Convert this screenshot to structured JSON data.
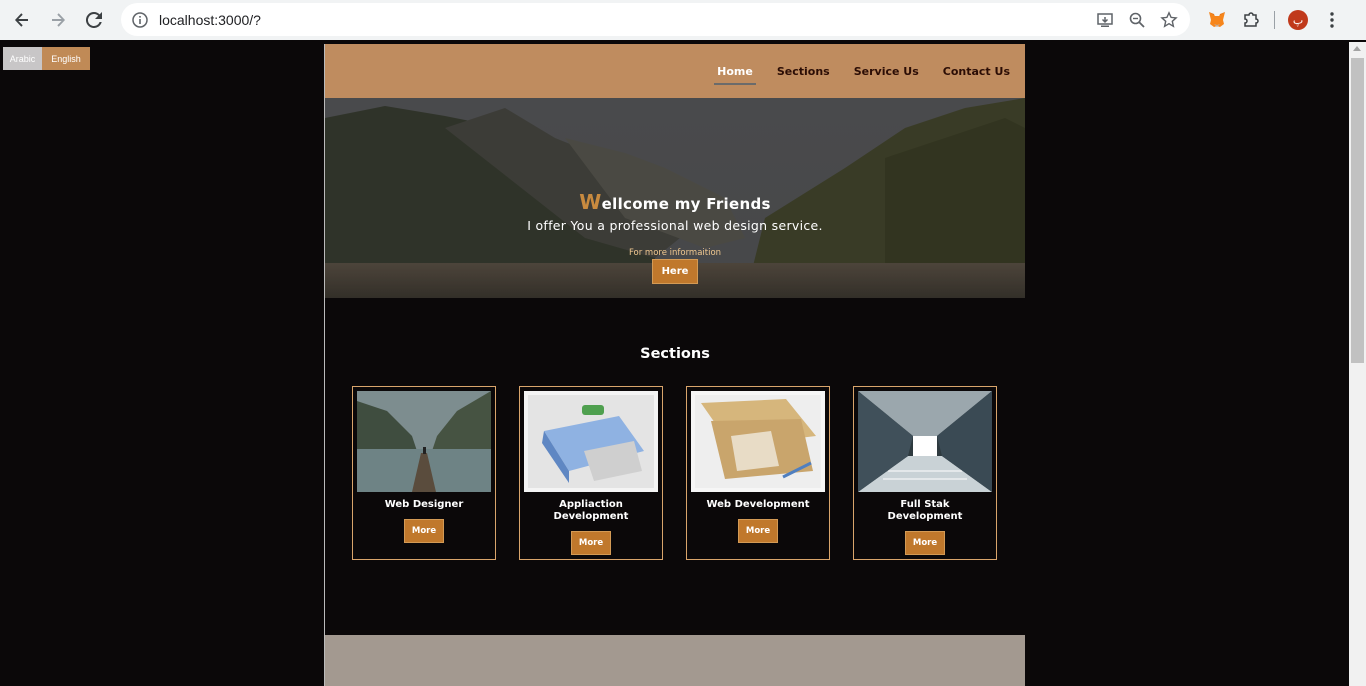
{
  "browser": {
    "url": "localhost:3000/?",
    "profile_initial": "پ"
  },
  "lang_switch": {
    "arabic": "Arabic",
    "english": "English"
  },
  "nav": {
    "items": [
      {
        "label": "Home",
        "active": true
      },
      {
        "label": "Sections",
        "active": false
      },
      {
        "label": "Service Us",
        "active": false
      },
      {
        "label": "Contact Us",
        "active": false
      }
    ]
  },
  "hero": {
    "title_first_letter": "W",
    "title_rest": "ellcome my Friends",
    "subtitle": "I offer You a professional web design service.",
    "more_text": "For more informaition",
    "button": "Here"
  },
  "sections": {
    "title": "Sections",
    "cards": [
      {
        "title": "Web Designer",
        "button": "More",
        "image": "lake-landscape"
      },
      {
        "title": "Appliaction Development",
        "button": "More",
        "image": "blue-binder"
      },
      {
        "title": "Web Development",
        "button": "More",
        "image": "folder-with-pen"
      },
      {
        "title": "Full Stak Development",
        "button": "More",
        "image": "futuristic-tunnel"
      }
    ]
  },
  "colors": {
    "accent": "#c0782c",
    "navbar": "#bf8c5f",
    "background": "#0b0809",
    "card_border": "#d9a46b"
  }
}
